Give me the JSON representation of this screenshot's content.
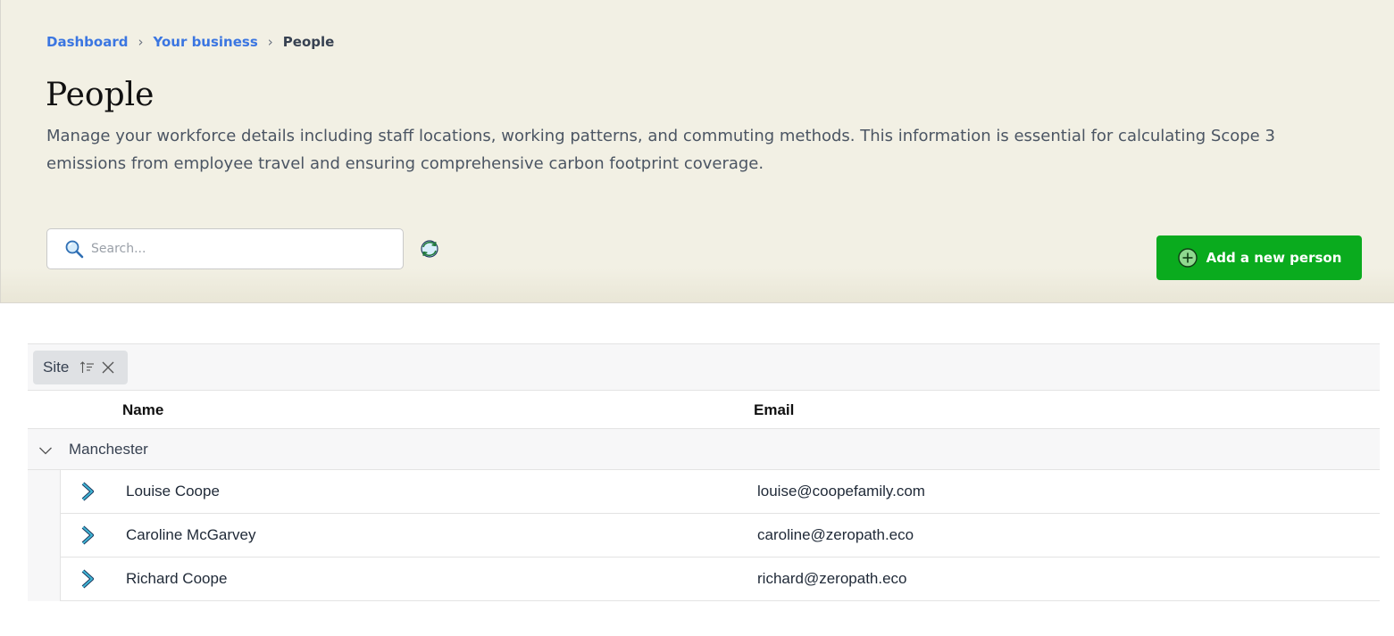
{
  "breadcrumb": {
    "items": [
      {
        "label": "Dashboard"
      },
      {
        "label": "Your business"
      }
    ],
    "current": "People"
  },
  "page": {
    "title": "People",
    "description": "Manage your workforce details including staff locations, working patterns, and commuting methods. This information is essential for calculating Scope 3 emissions from employee travel and ensuring comprehensive carbon footprint coverage."
  },
  "search": {
    "placeholder": "Search...",
    "value": "",
    "icon": "search-icon"
  },
  "toolbar": {
    "refresh_icon": "refresh-icon",
    "add_label": "Add a new person",
    "add_icon": "plus-circle-icon",
    "add_color": "#0aab1e"
  },
  "grid": {
    "group_chip": {
      "label": "Site"
    },
    "columns": [
      {
        "label": "Name"
      },
      {
        "label": "Email"
      }
    ],
    "groups": [
      {
        "label": "Manchester",
        "expanded": true,
        "rows": [
          {
            "name": "Louise Coope",
            "email": "louise@coopefamily.com"
          },
          {
            "name": "Caroline McGarvey",
            "email": "caroline@zeropath.eco"
          },
          {
            "name": "Richard Coope",
            "email": "richard@zeropath.eco"
          }
        ]
      }
    ]
  },
  "colors": {
    "link": "#3b76e1",
    "hero_bg": "#f2f0e4",
    "primary": "#0aab1e"
  }
}
